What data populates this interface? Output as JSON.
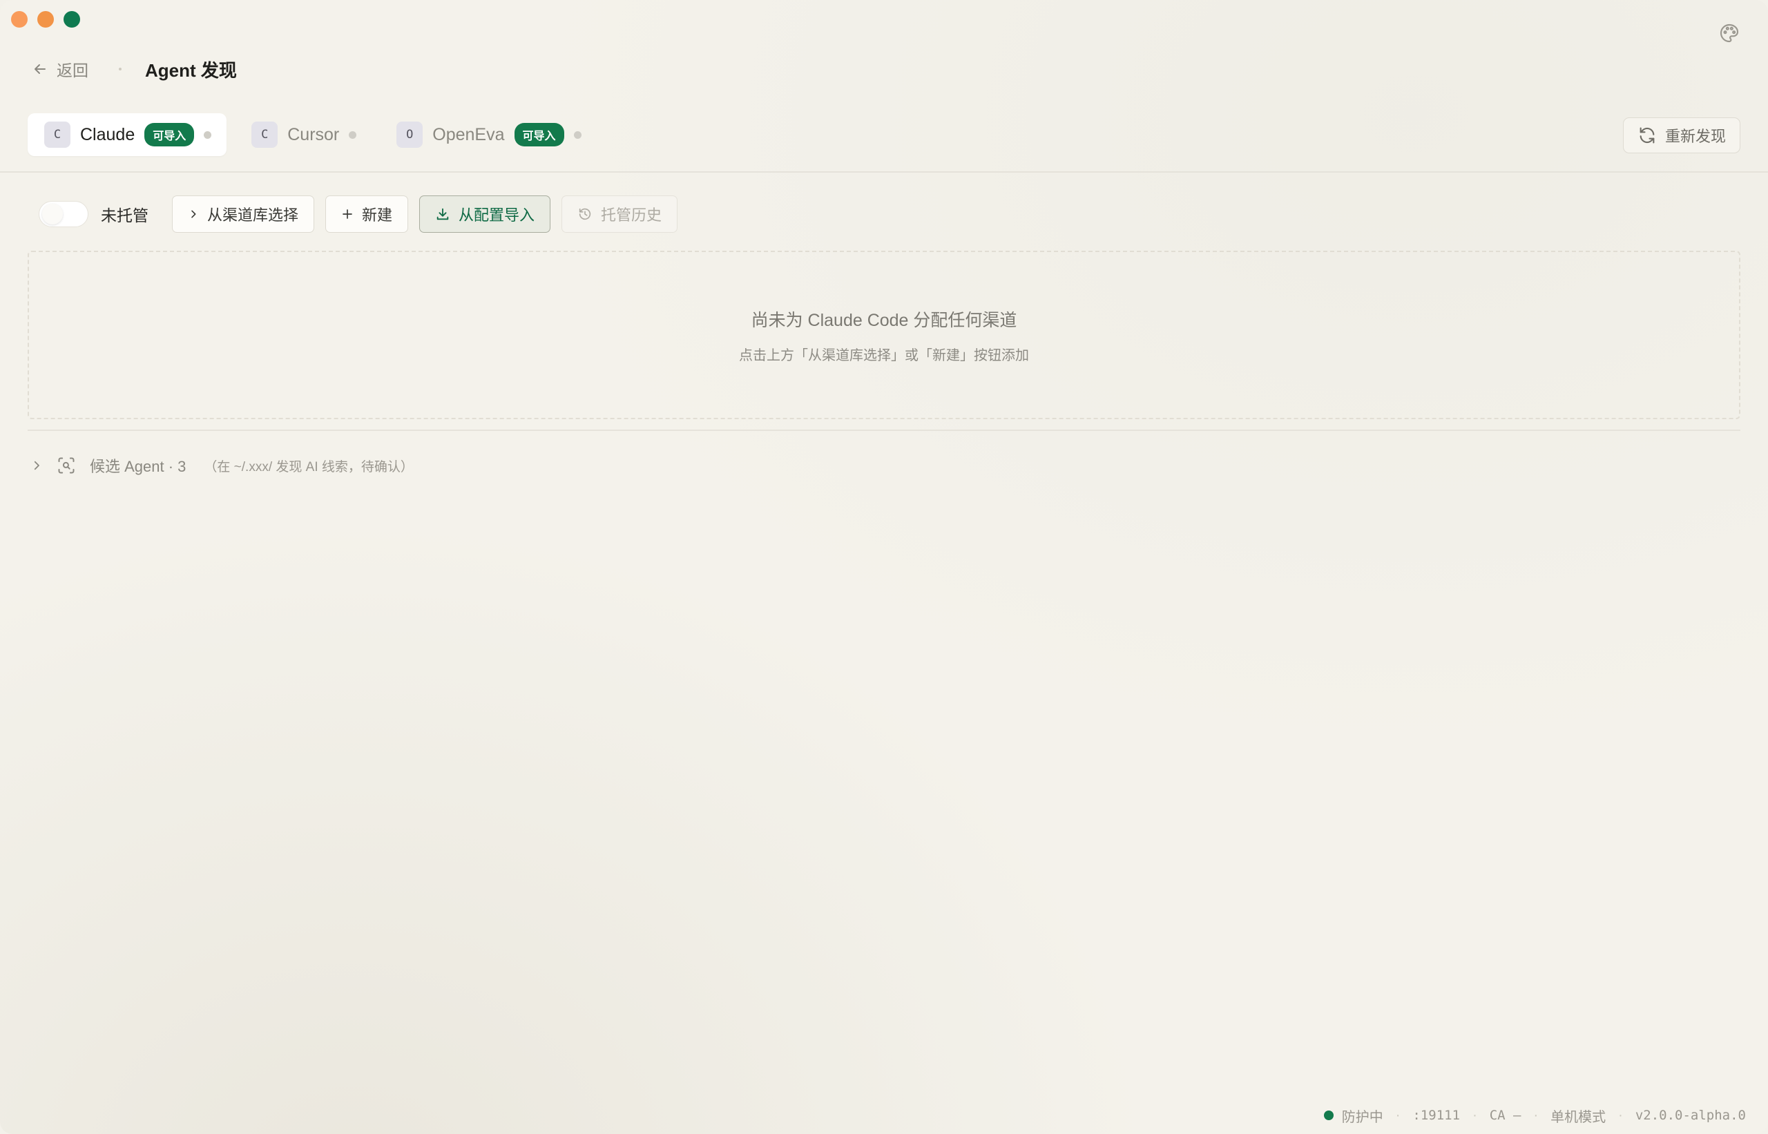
{
  "header": {
    "back_label": "返回",
    "title": "Agent 发现"
  },
  "tabs": [
    {
      "avatar": "C",
      "label": "Claude",
      "badge": "可导入",
      "active": true
    },
    {
      "avatar": "C",
      "label": "Cursor",
      "badge": "",
      "active": false
    },
    {
      "avatar": "O",
      "label": "OpenEva",
      "badge": "可导入",
      "active": false
    }
  ],
  "rediscover_label": "重新发现",
  "toolbar": {
    "toggle_label": "未托管",
    "channel_lib_label": "从渠道库选择",
    "new_label": "新建",
    "import_label": "从配置导入",
    "history_label": "托管历史"
  },
  "empty": {
    "title": "尚未为 Claude Code 分配任何渠道",
    "subtitle": "点击上方「从渠道库选择」或「新建」按钮添加"
  },
  "candidates": {
    "label": "候选 Agent · 3",
    "hint": "（在 ~/.xxx/ 发现 AI 线索，待确认）"
  },
  "status": {
    "protect": "防护中",
    "port": ":19111",
    "ca": "CA —",
    "mode": "单机模式",
    "version": "v2.0.0-alpha.0"
  },
  "colors": {
    "accent": "#137a4c",
    "background": "#f4f2eb"
  }
}
